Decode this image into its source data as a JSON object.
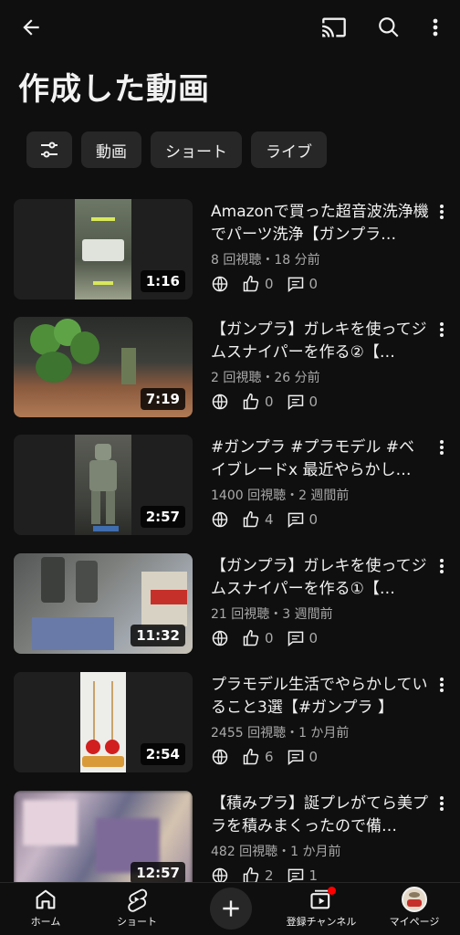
{
  "header": {
    "back_icon": "arrow-left-icon",
    "cast_icon": "cast-icon",
    "search_icon": "search-icon",
    "more_icon": "more-vert-icon"
  },
  "page_title": "作成した動画",
  "chips": [
    "動画",
    "ショート",
    "ライブ"
  ],
  "videos": [
    {
      "title": "Amazonで買った超音波洗浄機でパーツ洗浄【ガンプラ…",
      "meta": "8 回視聴・18 分前",
      "duration": "1:16",
      "likes": "0",
      "comments": "0"
    },
    {
      "title": "【ガンプラ】ガレキを使ってジムスナイパーを作る②【…",
      "meta": "2 回視聴・26 分前",
      "duration": "7:19",
      "likes": "0",
      "comments": "0"
    },
    {
      "title": "#ガンプラ #プラモデル #ベイブレードx 最近やらかし…",
      "meta": "1400 回視聴・2 週間前",
      "duration": "2:57",
      "likes": "4",
      "comments": "0"
    },
    {
      "title": "【ガンプラ】ガレキを使ってジムスナイパーを作る①【…",
      "meta": "21 回視聴・3 週間前",
      "duration": "11:32",
      "likes": "0",
      "comments": "0"
    },
    {
      "title": "プラモデル生活でやらかしていること3選【#ガンプラ 】",
      "meta": "2455 回視聴・1 か月前",
      "duration": "2:54",
      "likes": "6",
      "comments": "0"
    },
    {
      "title": "【積みプラ】誕プレがてら美プラを積みまくったので備…",
      "meta": "482 回視聴・1 か月前",
      "duration": "12:57",
      "likes": "2",
      "comments": "1"
    }
  ],
  "nav": {
    "home": "ホーム",
    "shorts": "ショート",
    "subscriptions": "登録チャンネル",
    "mypage": "マイページ"
  },
  "colors": {
    "background": "#0f0f0f",
    "chip": "#272727",
    "text": "#f1f1f1",
    "secondary": "#aaaaaa",
    "badge": "#ff0000"
  }
}
